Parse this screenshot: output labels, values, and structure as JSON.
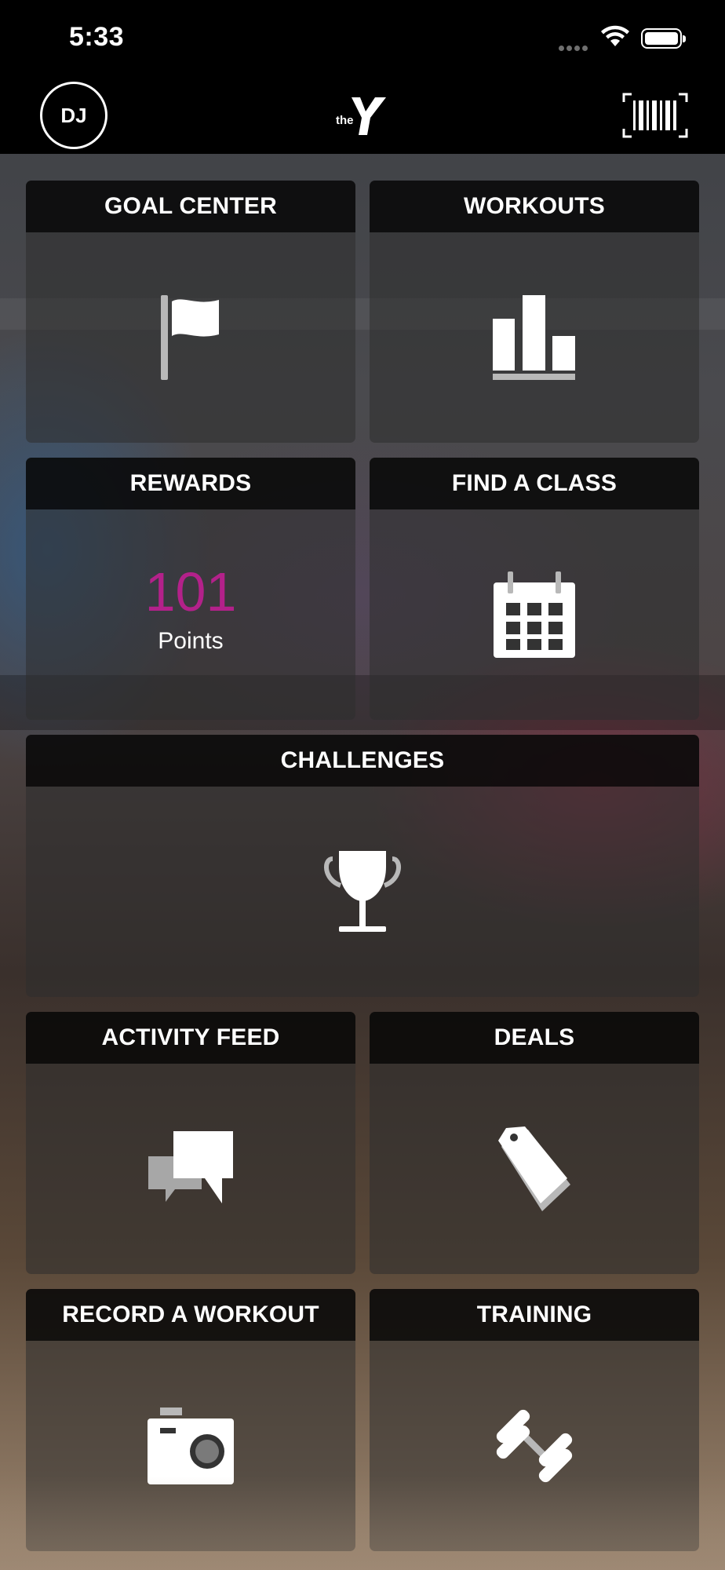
{
  "status_bar": {
    "time": "5:33"
  },
  "header": {
    "avatar_initials": "DJ",
    "logo_text": "the",
    "logo_letter": "Y",
    "barcode_icon": "barcode-icon"
  },
  "tiles": {
    "goal_center": {
      "title": "GOAL CENTER",
      "icon": "flag-icon"
    },
    "workouts": {
      "title": "WORKOUTS",
      "icon": "bar-chart-icon"
    },
    "rewards": {
      "title": "REWARDS",
      "points": "101",
      "points_label": "Points"
    },
    "find_a_class": {
      "title": "FIND A CLASS",
      "icon": "calendar-icon"
    },
    "challenges": {
      "title": "CHALLENGES",
      "icon": "trophy-icon"
    },
    "activity_feed": {
      "title": "ACTIVITY FEED",
      "icon": "chat-bubbles-icon"
    },
    "deals": {
      "title": "DEALS",
      "icon": "price-tag-icon"
    },
    "record_a_workout": {
      "title": "RECORD A WORKOUT",
      "icon": "camera-icon"
    },
    "training": {
      "title": "TRAINING",
      "icon": "dumbbell-icon"
    }
  },
  "colors": {
    "accent_points": "#b3218a",
    "header_bg": "#000000",
    "tile_header_bg": "rgba(0,0,0,0.72)"
  }
}
